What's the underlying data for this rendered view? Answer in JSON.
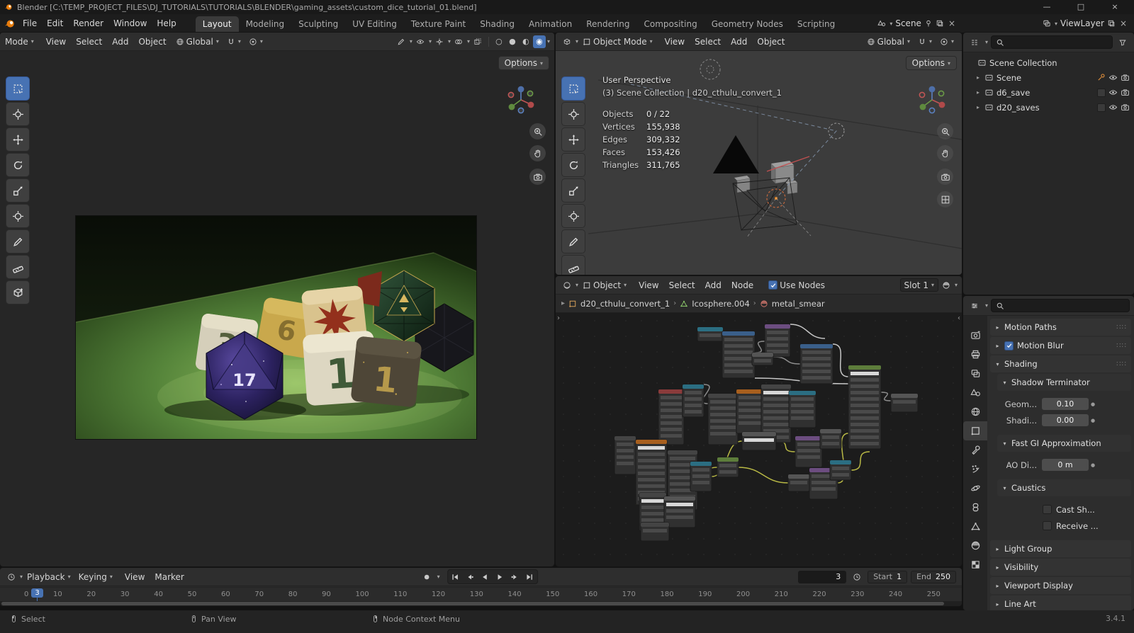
{
  "titlebar": {
    "title": "Blender [C:\\TEMP_PROJECT_FILES\\DJ_TUTORIALS\\TUTORIALS\\BLENDER\\gaming_assets\\custom_dice_tutorial_01.blend]",
    "minimize": "—",
    "maximize": "□",
    "close": "×"
  },
  "menubar": {
    "menus": [
      "File",
      "Edit",
      "Render",
      "Window",
      "Help"
    ],
    "workspaces": [
      "Layout",
      "Modeling",
      "Sculpting",
      "UV Editing",
      "Texture Paint",
      "Shading",
      "Animation",
      "Rendering",
      "Compositing",
      "Geometry Nodes",
      "Scripting"
    ],
    "scene": "Scene",
    "view_layer": "ViewLayer"
  },
  "viewport_left": {
    "mode_label": "Mode",
    "menus": [
      "View",
      "Select",
      "Add",
      "Object"
    ],
    "orientation": "Global",
    "options_label": "Options",
    "tools": [
      "select-box",
      "cursor",
      "move",
      "rotate",
      "scale",
      "transform",
      "annotate",
      "measure",
      "add-cube"
    ],
    "dice_labels": [
      "3",
      "6",
      "17",
      "1",
      "1"
    ]
  },
  "viewport_right": {
    "mode": "Object Mode",
    "menus": [
      "View",
      "Select",
      "Add",
      "Object"
    ],
    "orientation": "Global",
    "options_label": "Options",
    "tools": [
      "select-box",
      "cursor",
      "move",
      "rotate",
      "scale",
      "transform",
      "annotate",
      "measure",
      "add-cube"
    ],
    "overlay": {
      "view_name": "User Perspective",
      "context_line": "(3) Scene Collection | d20_cthulu_convert_1",
      "stats": [
        {
          "label": "Objects",
          "value": "0 / 22"
        },
        {
          "label": "Vertices",
          "value": "155,938"
        },
        {
          "label": "Edges",
          "value": "309,332"
        },
        {
          "label": "Faces",
          "value": "153,426"
        },
        {
          "label": "Triangles",
          "value": "311,765"
        }
      ]
    }
  },
  "shader_editor": {
    "shader_type": "Object",
    "menus": [
      "View",
      "Select",
      "Add",
      "Node"
    ],
    "use_nodes_label": "Use Nodes",
    "slot_label": "Slot 1",
    "breadcrumb": [
      {
        "label": "d20_cthulu_convert_1"
      },
      {
        "label": "Icosphere.004"
      },
      {
        "label": "metal_smear"
      }
    ],
    "nodes": [
      [
        200,
        20,
        36,
        20,
        "#2b6e82",
        0
      ],
      [
        235,
        26,
        46,
        66,
        "#3a5f8a",
        0
      ],
      [
        295,
        16,
        36,
        46,
        "#6c4d80",
        0
      ],
      [
        277,
        56,
        30,
        18,
        "#555555",
        0
      ],
      [
        345,
        44,
        46,
        56,
        "#3a5f8a",
        0
      ],
      [
        413,
        74,
        46,
        118,
        "#5d7d3b",
        1
      ],
      [
        473,
        114,
        38,
        26,
        "#555555",
        0
      ],
      [
        145,
        108,
        36,
        78,
        "#8a3b3b",
        0
      ],
      [
        179,
        101,
        30,
        46,
        "#2b6e82",
        0
      ],
      [
        215,
        114,
        42,
        72,
        "#444444",
        0
      ],
      [
        255,
        108,
        38,
        62,
        "#a85f1e",
        0
      ],
      [
        290,
        101,
        42,
        82,
        "#444444",
        1
      ],
      [
        329,
        110,
        38,
        52,
        "#2b6e82",
        0
      ],
      [
        263,
        168,
        48,
        26,
        "#555555",
        1
      ],
      [
        338,
        174,
        38,
        44,
        "#6c4d80",
        0
      ],
      [
        373,
        164,
        30,
        28,
        "#555555",
        0
      ],
      [
        83,
        174,
        30,
        54,
        "#444444",
        0
      ],
      [
        113,
        179,
        44,
        92,
        "#a85f1e",
        1
      ],
      [
        158,
        194,
        42,
        84,
        "#444444",
        0
      ],
      [
        190,
        210,
        30,
        42,
        "#2b6e82",
        0
      ],
      [
        228,
        204,
        30,
        28,
        "#5d7d3b",
        0
      ],
      [
        328,
        228,
        30,
        24,
        "#555555",
        0
      ],
      [
        358,
        219,
        40,
        44,
        "#6c4d80",
        0
      ],
      [
        387,
        208,
        30,
        28,
        "#2b6e82",
        0
      ],
      [
        118,
        254,
        38,
        54,
        "#444444",
        1
      ],
      [
        153,
        259,
        44,
        44,
        "#555555",
        1
      ],
      [
        120,
        296,
        40,
        26,
        "#444444",
        0
      ]
    ],
    "wires": [
      [
        157,
        225,
        190,
        231,
        "y"
      ],
      [
        113,
        270,
        153,
        281,
        "y"
      ],
      [
        200,
        236,
        228,
        218,
        "y"
      ],
      [
        220,
        231,
        263,
        181,
        "y"
      ],
      [
        258,
        218,
        328,
        240,
        "y"
      ],
      [
        398,
        240,
        413,
        170,
        "y"
      ],
      [
        311,
        181,
        338,
        196,
        "y"
      ],
      [
        417,
        222,
        443,
        196,
        "y"
      ],
      [
        281,
        56,
        295,
        40,
        "g"
      ],
      [
        307,
        62,
        345,
        72,
        "g"
      ],
      [
        209,
        101,
        215,
        128,
        "g"
      ],
      [
        459,
        112,
        473,
        124,
        "g"
      ],
      [
        331,
        16,
        380,
        36,
        "w"
      ],
      [
        391,
        44,
        413,
        90,
        "w"
      ],
      [
        281,
        92,
        413,
        100,
        "w"
      ]
    ]
  },
  "outliner": {
    "rows": [
      {
        "label": "Scene Collection",
        "arrow": false,
        "right": []
      },
      {
        "label": "Scene",
        "arrow": true,
        "right": [
          "tool",
          "eye",
          "cam"
        ]
      },
      {
        "label": "d6_save",
        "arrow": true,
        "right": [
          "check",
          "eye",
          "cam"
        ]
      },
      {
        "label": "d20_saves",
        "arrow": true,
        "right": [
          "check",
          "eye",
          "cam"
        ]
      }
    ]
  },
  "properties": {
    "tabs": [
      {
        "name": "render",
        "color": "#c0c0c0"
      },
      {
        "name": "printer",
        "color": "#c0c0c0"
      },
      {
        "name": "layers",
        "color": "#c0c0c0"
      },
      {
        "name": "scenecone",
        "color": "#c0c0c0"
      },
      {
        "name": "world",
        "color": "#b8c4cf"
      },
      {
        "name": "object",
        "color": "#e8a15c",
        "active": true
      },
      {
        "name": "modifiers",
        "color": "#84a8d0"
      },
      {
        "name": "particles",
        "color": "#84a8d0"
      },
      {
        "name": "physics",
        "color": "#84a8d0"
      },
      {
        "name": "constraints",
        "color": "#84a8d0"
      },
      {
        "name": "data",
        "color": "#8fce6c"
      },
      {
        "name": "matball",
        "color": "#d0756c"
      },
      {
        "name": "texture",
        "color": "#e09a5c"
      }
    ],
    "panels": {
      "motion_paths": "Motion Paths",
      "motion_blur": "Motion Blur",
      "shading": "Shading",
      "shadow_terminator": "Shadow Terminator",
      "geometry_offset_label": "Geom...",
      "geometry_offset_value": "0.10",
      "shading_offset_label": "Shadi...",
      "shading_offset_value": "0.00",
      "fast_gi": "Fast GI Approximation",
      "ao_distance_label": "AO Di...",
      "ao_distance_value": "0 m",
      "caustics": "Caustics",
      "cast_shadow": "Cast Sh...",
      "receive_shadow": "Receive ...",
      "light_group": "Light Group",
      "visibility": "Visibility",
      "viewport_display": "Viewport Display",
      "line_art": "Line Art"
    }
  },
  "timeline": {
    "playback_label": "Playback",
    "keying_label": "Keying",
    "menus": [
      "View",
      "Marker"
    ],
    "current_frame": "3",
    "start_label": "Start",
    "start_value": "1",
    "end_label": "End",
    "end_value": "250",
    "ruler": [
      "0",
      "10",
      "20",
      "30",
      "40",
      "50",
      "60",
      "70",
      "80",
      "90",
      "100",
      "110",
      "120",
      "130",
      "140",
      "150",
      "160",
      "170",
      "180",
      "190",
      "200",
      "210",
      "220",
      "230",
      "240",
      "250"
    ],
    "playhead_label": "3"
  },
  "statusbar": {
    "left_items": [
      {
        "icon": "mouse-left",
        "label": "Select"
      },
      {
        "icon": "mouse-middle",
        "label": "Pan View"
      },
      {
        "icon": "mouse-right",
        "label": "Node Context Menu"
      }
    ],
    "version": "3.4.1"
  },
  "colors": {
    "accent": "#4772b3",
    "orange": "#e87d0d"
  }
}
